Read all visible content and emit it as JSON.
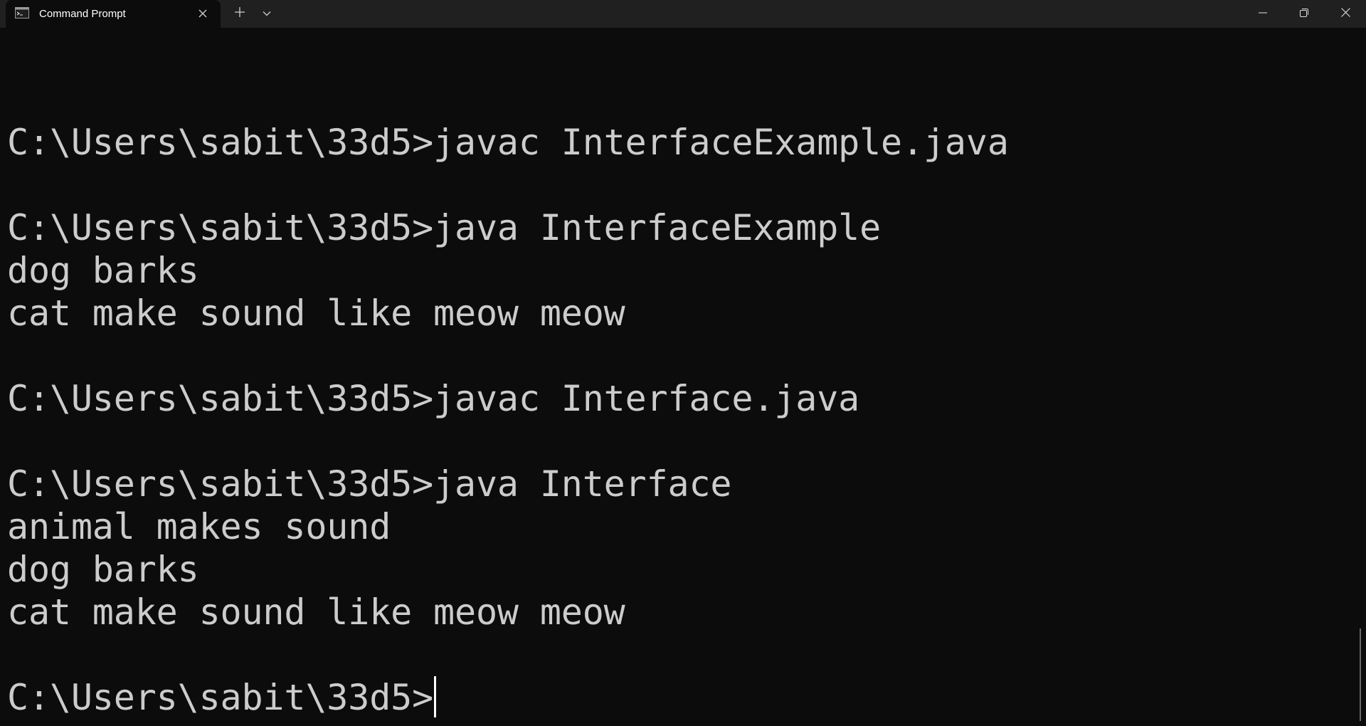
{
  "window": {
    "tab_title": "Command Prompt",
    "icons": {
      "tab": "command-prompt-icon",
      "tab_close": "close-icon",
      "new_tab": "plus-icon",
      "dropdown": "chevron-down-icon",
      "minimize": "minimize-icon",
      "restore": "restore-icon",
      "close": "close-icon"
    }
  },
  "terminal": {
    "lines": [
      "C:\\Users\\sabit\\33d5>javac InterfaceExample.java",
      "",
      "C:\\Users\\sabit\\33d5>java InterfaceExample",
      "dog barks",
      "cat make sound like meow meow",
      "",
      "C:\\Users\\sabit\\33d5>javac Interface.java",
      "",
      "C:\\Users\\sabit\\33d5>java Interface",
      "animal makes sound",
      "dog barks",
      "cat make sound like meow meow",
      "",
      "C:\\Users\\sabit\\33d5>"
    ]
  },
  "colors": {
    "background": "#0c0c0c",
    "titlebar": "#202020",
    "text": "#cccccc"
  }
}
